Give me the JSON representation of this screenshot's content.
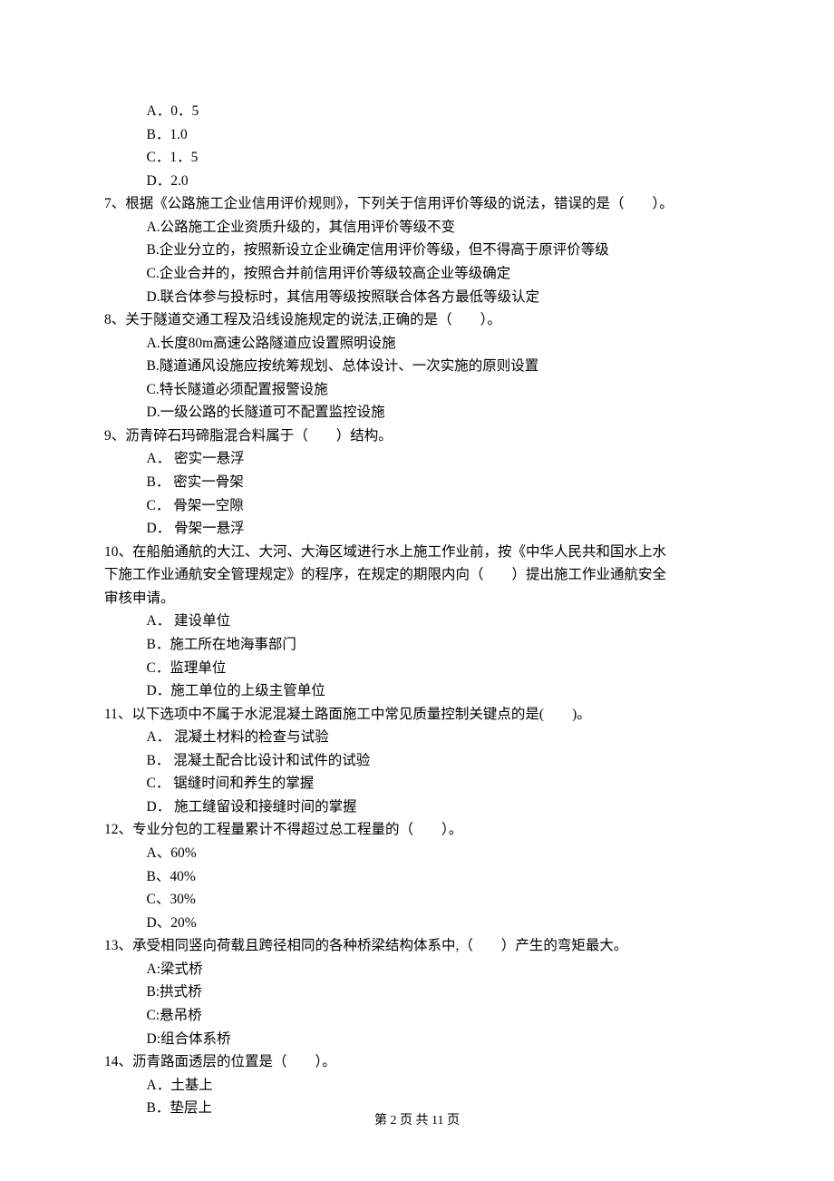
{
  "q6": {
    "optA": "A．0．5",
    "optB": "B．1.0",
    "optC": "C．1．5",
    "optD": "D．2.0"
  },
  "q7": {
    "stem": "7、根据《公路施工企业信用评价规则》，下列关于信用评价等级的说法，错误的是（　　）。",
    "optA": "A.公路施工企业资质升级的，其信用评价等级不变",
    "optB": "B.企业分立的，按照新设立企业确定信用评价等级，但不得高于原评价等级",
    "optC": "C.企业合并的，按照合并前信用评价等级较高企业等级确定",
    "optD": "D.联合体参与投标时，其信用等级按照联合体各方最低等级认定"
  },
  "q8": {
    "stem": "8、关于隧道交通工程及沿线设施规定的说法,正确的是（　　）。",
    "optA": "A.长度80m高速公路隧道应设置照明设施",
    "optB": "B.隧道通风设施应按统筹规划、总体设计、一次实施的原则设置",
    "optC": "C.特长隧道必须配置报警设施",
    "optD": "D.一级公路的长隧道可不配置监控设施"
  },
  "q9": {
    "stem": "9、沥青碎石玛碲脂混合料属于（　　）结构。",
    "optA": "A． 密实一悬浮",
    "optB": "B． 密实一骨架",
    "optC": "C． 骨架一空隙",
    "optD": "D． 骨架一悬浮"
  },
  "q10": {
    "stem1": "10、在船舶通航的大江、大河、大海区域进行水上施工作业前，按《中华人民共和国水上水",
    "stem2": "下施工作业通航安全管理规定》的程序，在规定的期限内向（　　）提出施工作业通航安全",
    "stem3": "审核申请。",
    "optA": "A． 建设单位",
    "optB": "B．施工所在地海事部门",
    "optC": "C．监理单位",
    "optD": "D．施工单位的上级主管单位"
  },
  "q11": {
    "stem": "11、以下选项中不属于水泥混凝土路面施工中常见质量控制关键点的是(　　)。",
    "optA": "A． 混凝土材料的检查与试验",
    "optB": "B． 混凝土配合比设计和试件的试验",
    "optC": "C． 锯缝时间和养生的掌握",
    "optD": "D． 施工缝留设和接缝时间的掌握"
  },
  "q12": {
    "stem": "12、专业分包的工程量累计不得超过总工程量的（　　）。",
    "optA": "A、60%",
    "optB": "B、40%",
    "optC": "C、30%",
    "optD": "D、20%"
  },
  "q13": {
    "stem": "13、承受相同竖向荷载且跨径相同的各种桥梁结构体系中,（　　）产生的弯矩最大。",
    "optA": "A:梁式桥",
    "optB": "B:拱式桥",
    "optC": "C:悬吊桥",
    "optD": "D:组合体系桥"
  },
  "q14": {
    "stem": "14、沥青路面透层的位置是（　　）。",
    "optA": "A．土基上",
    "optB": "B．垫层上"
  },
  "footer": "第 2 页 共 11 页"
}
